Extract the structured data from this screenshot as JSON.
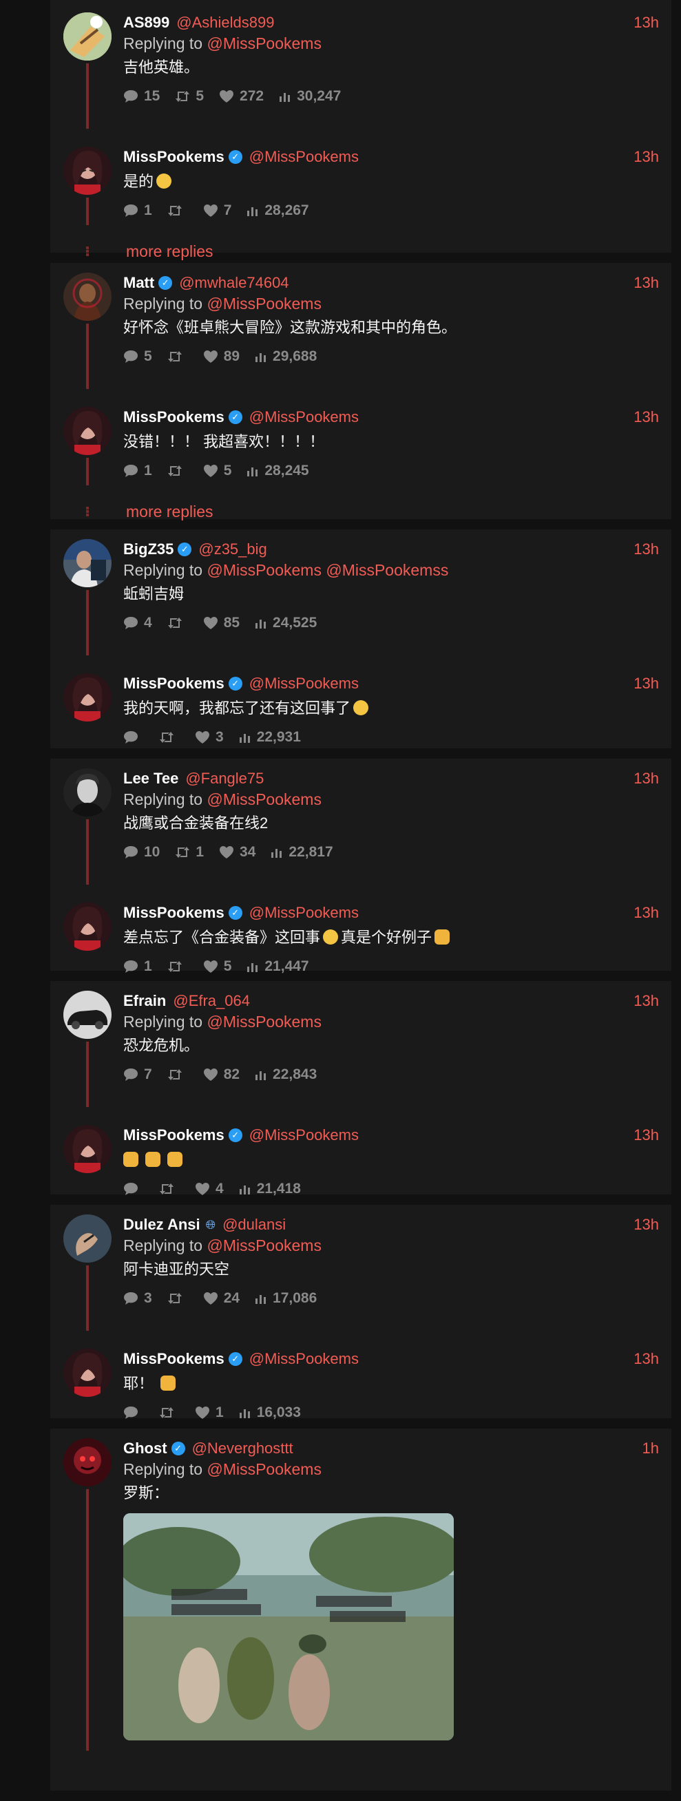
{
  "threads": [
    {
      "parent": {
        "name": "AS899",
        "handle": "@Ashields899",
        "time": "13h",
        "replying_label": "Replying to",
        "replying_to": "@MissPookems",
        "text": "吉他英雄。",
        "replies": "15",
        "retweets": "5",
        "likes": "272",
        "views": "30,247",
        "verified": false
      },
      "reply": {
        "name": "MissPookems",
        "handle": "@MissPookems",
        "time": "13h",
        "text": "是的",
        "replies": "1",
        "retweets": "",
        "likes": "7",
        "views": "28,267",
        "verified": true
      },
      "more": "more replies"
    },
    {
      "parent": {
        "name": "Matt",
        "handle": "@mwhale74604",
        "time": "13h",
        "replying_label": "Replying to",
        "replying_to": "@MissPookems",
        "text": "好怀念《班卓熊大冒险》这款游戏和其中的角色。",
        "replies": "5",
        "retweets": "",
        "likes": "89",
        "views": "29,688",
        "verified": true
      },
      "reply": {
        "name": "MissPookems",
        "handle": "@MissPookems",
        "time": "13h",
        "text": "没错！！！ 我超喜欢！！！！",
        "replies": "1",
        "retweets": "",
        "likes": "5",
        "views": "28,245",
        "verified": true
      },
      "more": "more replies"
    },
    {
      "parent": {
        "name": "BigZ35",
        "handle": "@z35_big",
        "time": "13h",
        "replying_label": "Replying to",
        "replying_to": "@MissPookems @MissPookemss",
        "text": "蚯蚓吉姆",
        "replies": "4",
        "retweets": "",
        "likes": "85",
        "views": "24,525",
        "verified": true
      },
      "reply": {
        "name": "MissPookems",
        "handle": "@MissPookems",
        "time": "13h",
        "text": "我的天啊，我都忘了还有这回事了",
        "replies": "",
        "retweets": "",
        "likes": "3",
        "views": "22,931",
        "verified": true
      }
    },
    {
      "parent": {
        "name": "Lee Tee",
        "handle": "@Fangle75",
        "time": "13h",
        "replying_label": "Replying to",
        "replying_to": "@MissPookems",
        "text": "战鹰或合金装备在线2",
        "replies": "10",
        "retweets": "1",
        "likes": "34",
        "views": "22,817",
        "verified": false
      },
      "reply": {
        "name": "MissPookems",
        "handle": "@MissPookems",
        "time": "13h",
        "text_a": "差点忘了《合金装备》这回事",
        "text_b": "真是个好例子",
        "replies": "1",
        "retweets": "",
        "likes": "5",
        "views": "21,447",
        "verified": true
      }
    },
    {
      "parent": {
        "name": "Efrain",
        "handle": "@Efra_064",
        "time": "13h",
        "replying_label": "Replying to",
        "replying_to": "@MissPookems",
        "text": "恐龙危机。",
        "replies": "7",
        "retweets": "",
        "likes": "82",
        "views": "22,843",
        "verified": false
      },
      "reply": {
        "name": "MissPookems",
        "handle": "@MissPookems",
        "time": "13h",
        "text": "",
        "replies": "",
        "retweets": "",
        "likes": "4",
        "views": "21,418",
        "verified": true
      }
    },
    {
      "parent": {
        "name": "Dulez Ansi",
        "handle": "@dulansi",
        "time": "13h",
        "replying_label": "Replying to",
        "replying_to": "@MissPookems",
        "text": "阿卡迪亚的天空",
        "replies": "3",
        "retweets": "",
        "likes": "24",
        "views": "17,086",
        "verified": false
      },
      "reply": {
        "name": "MissPookems",
        "handle": "@MissPookems",
        "time": "13h",
        "text": "耶！",
        "replies": "",
        "retweets": "",
        "likes": "1",
        "views": "16,033",
        "verified": true
      }
    },
    {
      "parent": {
        "name": "Ghost",
        "handle": "@Neverghosttt",
        "time": "1h",
        "replying_label": "Replying to",
        "replying_to": "@MissPookems",
        "text": "罗斯：",
        "verified": true
      }
    }
  ],
  "colors": {
    "accent": "#f25c54",
    "thread_line": "#7a2a2a",
    "card": "#1a1a1b",
    "background": "#111112",
    "verified": "#2a9df4"
  }
}
